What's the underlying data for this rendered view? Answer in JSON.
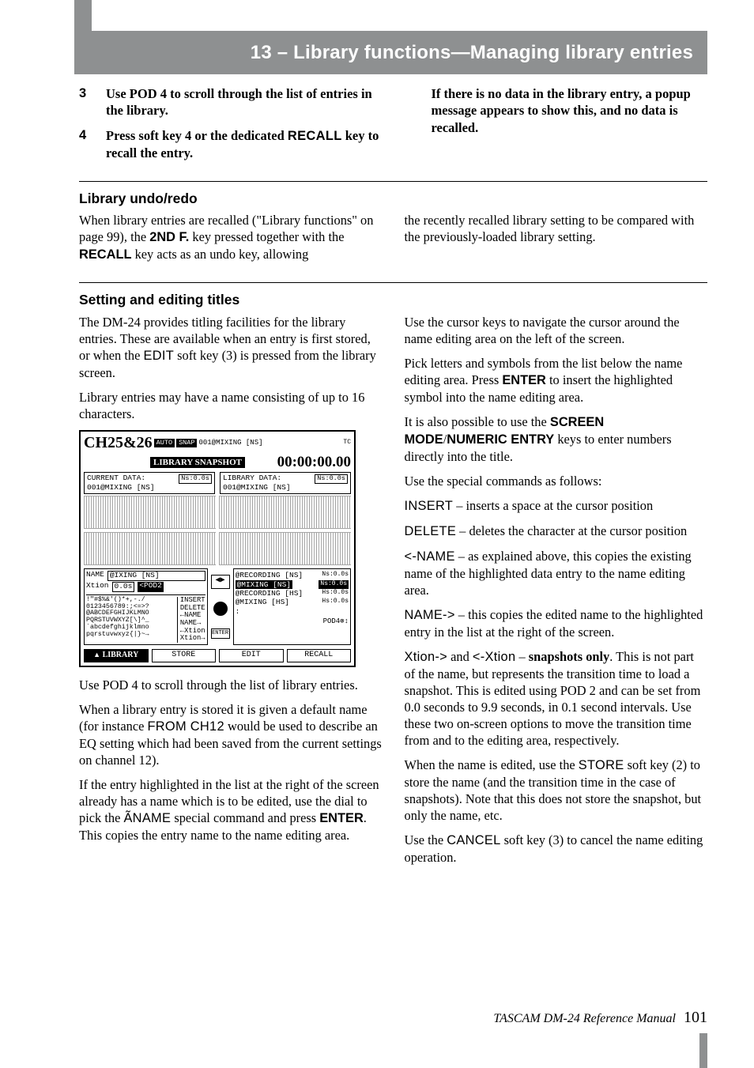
{
  "header": {
    "title": "13 – Library functions—Managing library entries"
  },
  "steps": {
    "s3_num": "3",
    "s3_text_a": "Use POD 4 to scroll through the list of entries in the library.",
    "s4_num": "4",
    "s4_text_a": "Press soft key 4 or the dedicated ",
    "s4_recall": "RECALL",
    "s4_text_b": " key to recall the entry.",
    "s_right": "If there is no data in the library entry, a popup message appears to show this, and no data is recalled."
  },
  "section_undo": {
    "heading": "Library undo/redo",
    "p1_a": "When library entries are recalled (\"Library functions\" on page 99), the ",
    "p1_b": "2ND F.",
    "p1_c": " key pressed together with the ",
    "p1_d": "RECALL",
    "p1_e": " key acts as an undo key, allowing",
    "p2": "the recently recalled library setting to be compared with the previously-loaded library setting."
  },
  "section_titles": {
    "heading": "Setting and editing titles",
    "left": {
      "p1_a": "The DM-24 provides titling facilities for the library entries. These are available when an entry is first stored, or when the ",
      "p1_edit": "EDIT",
      "p1_b": " soft key (3) is pressed from the library screen.",
      "p2": "Library entries may have a name consisting of up to 16 characters.",
      "p3": "Use POD 4 to scroll through the list of library entries.",
      "p4_a": "When a library entry is stored it is given a default name (for instance ",
      "p4_from": "FROM CH12",
      "p4_b": " would be used to describe an EQ setting which had been saved from the current settings on channel 12).",
      "p5_a": "If the entry highlighted in the list at the right of the screen already has a name which is to be edited, use the dial to pick the ",
      "p5_name": "ÃNAME",
      "p5_b": " special command and press ",
      "p5_enter": "ENTER",
      "p5_c": ". This copies the entry name to the name editing area."
    },
    "right": {
      "p1": "Use the cursor keys to navigate the cursor around the name editing area on the left of the screen.",
      "p2_a": "Pick letters and symbols from the list below the name editing area. Press ",
      "p2_enter": "ENTER",
      "p2_b": " to insert the highlighted symbol into the name editing area.",
      "p3_a": "It is also possible to use the ",
      "p3_sm": "SCREEN MODE",
      "p3_slash": "/",
      "p3_ne": "NUMERIC ENTRY",
      "p3_b": " keys to enter numbers directly into the title.",
      "p4": "Use the special commands as follows:",
      "p5_a": "INSERT",
      "p5_b": " – inserts a space at the cursor position",
      "p6_a": "DELETE",
      "p6_b": " – deletes the character at the cursor position",
      "p7_a": "<-NAME",
      "p7_b": " – as explained above, this copies the existing name of the highlighted data entry to the name editing area.",
      "p8_a": "NAME->",
      "p8_b": " – this copies the edited name to the highlighted entry in the list at the right of the screen.",
      "p9_a": "Xtion->",
      "p9_and": " and ",
      "p9_b": "<-Xtion",
      "p9_dash": " – ",
      "p9_bold": "snapshots only",
      "p9_c": ". This is not part of the name, but represents the transition time to load a snapshot. This is edited using POD 2 and can be set from 0.0 seconds to 9.9 seconds, in 0.1 second intervals. Use these two on-screen options to move the transition time from and to the editing area, respectively.",
      "p10_a": "When the name is edited, use the ",
      "p10_store": "STORE",
      "p10_b": " soft key (2) to store the name (and the transition time in the case of snapshots). Note that this does not store the snapshot, but only the name, etc.",
      "p11_a": "Use the ",
      "p11_cancel": "CANCEL",
      "p11_b": " soft key (3) to cancel the name editing operation."
    }
  },
  "figure": {
    "ch": "CH25&26",
    "auto": "AUTO",
    "snap_code": "SNAP",
    "snap_mix": "001@MIXING  [NS]",
    "snap_label": "LIBRARY SNAPSHOT",
    "tc": "00:00:00.00",
    "tc_suffix": "TC",
    "curL_a": "CURRENT DATA:",
    "curL_b": "001@MIXING  [NS]",
    "ns_l": "Ns:0.0s",
    "curR_a": "LIBRARY DATA:",
    "curR_b": "001@MIXING  [NS]",
    "ns_r": "Ns:0.0s",
    "name_row_a": "NAME",
    "name_row_b": "@IXING  [NS]",
    "xtion_a": "Xtion",
    "xtion_b": "0.0s",
    "pod2": "<POD2",
    "charset1": " !\"#$%&'()*+,-./",
    "charset2": "0123456789:;<=>?",
    "charset3": "@ABCDEFGHIJKLMNO",
    "charset4": "PQRSTUVWXYZ[\\]^_",
    "charset5": "`abcdefghijklmno",
    "charset6": "pqrstuvwxyz{|}~→",
    "cmd1": "INSERT",
    "cmd2": "DELETE",
    "cmd3": "←NAME",
    "cmd4": "NAME→",
    "cmd5": "←Xtion",
    "cmd6": "Xtion→",
    "enter": "ENTER",
    "list0": "@RECORDING [NS]",
    "list0_ns": "Ns:0.0s",
    "list1": "@MIXING   [NS]",
    "list1_ns": "Ns:0.0s",
    "list2": "@RECORDING [HS]",
    "list2_ns": "Hs:0.0s",
    "list3": "@MIXING   [HS]",
    "list3_ns": "Hs:0.0s",
    "list_colon": ":",
    "pod4": "POD4⊚↕",
    "tabs": {
      "t1": "LIBRARY",
      "t2": "STORE",
      "t3": "EDIT",
      "t4": "RECALL"
    }
  },
  "footer": {
    "book": "TASCAM DM-24 Reference Manual",
    "page": "101"
  }
}
